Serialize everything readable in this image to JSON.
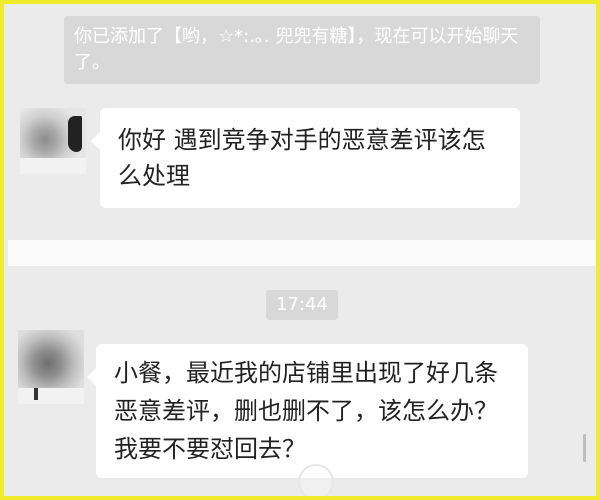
{
  "chat": {
    "system_message": "你已添加了【哟，☆*:.｡. 兜兜有糖】，现在可以开始聊天了。",
    "timestamp": "17:44",
    "messages": [
      {
        "text": "你好 遇到竞争对手的恶意差评该怎么处理"
      },
      {
        "text": "小餐，最近我的店铺里出现了好几条恶意差评，删也删不了，该怎么办？我要不要怼回去？"
      }
    ]
  },
  "theme": {
    "frame_border": "#f0ec2d",
    "chat_background": "#ebebeb",
    "separator_background": "#fbfbfb",
    "system_bubble": "#d8d8d8",
    "message_bubble": "#ffffff",
    "message_text": "#222222"
  },
  "icons": {
    "avatar_1": "blurred-avatar-photo",
    "avatar_2": "blurred-avatar-photo",
    "home_indicator": "circle-overlay-icon"
  }
}
